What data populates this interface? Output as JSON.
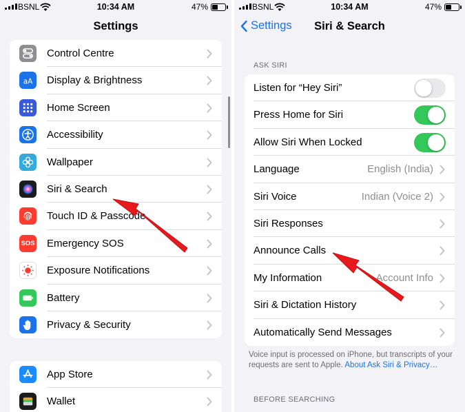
{
  "status": {
    "carrier": "BSNL",
    "time": "10:34 AM",
    "battery": "47%"
  },
  "left": {
    "title": "Settings",
    "group1": [
      {
        "label": "Control Centre",
        "icon": "control-centre-icon",
        "color": "#8e8e93"
      },
      {
        "label": "Display & Brightness",
        "icon": "display-brightness-icon",
        "color": "#1a73e8"
      },
      {
        "label": "Home Screen",
        "icon": "home-screen-icon",
        "color": "#3a5bd9"
      },
      {
        "label": "Accessibility",
        "icon": "accessibility-icon",
        "color": "#1a73e8"
      },
      {
        "label": "Wallpaper",
        "icon": "wallpaper-icon",
        "color": "#34aadc"
      },
      {
        "label": "Siri & Search",
        "icon": "siri-icon",
        "color": "#1c1c1e"
      },
      {
        "label": "Touch ID & Passcode",
        "icon": "fingerprint-icon",
        "color": "#ff3b30"
      },
      {
        "label": "Emergency SOS",
        "icon": "sos-icon",
        "color": "#ff3b30",
        "icon_text": "SOS"
      },
      {
        "label": "Exposure Notifications",
        "icon": "exposure-notifications-icon",
        "color": "#ffffff"
      },
      {
        "label": "Battery",
        "icon": "battery-icon",
        "color": "#34c759"
      },
      {
        "label": "Privacy & Security",
        "icon": "privacy-hand-icon",
        "color": "#1a73e8"
      }
    ],
    "group2": [
      {
        "label": "App Store",
        "icon": "app-store-icon",
        "color": "#1a8cff"
      },
      {
        "label": "Wallet",
        "icon": "wallet-icon",
        "color": "#1c1c1e"
      }
    ]
  },
  "right": {
    "back_label": "Settings",
    "title": "Siri & Search",
    "section1_header": "ASK SIRI",
    "rows": [
      {
        "label": "Listen for “Hey Siri”",
        "type": "toggle",
        "on": false
      },
      {
        "label": "Press Home for Siri",
        "type": "toggle",
        "on": true
      },
      {
        "label": "Allow Siri When Locked",
        "type": "toggle",
        "on": true
      },
      {
        "label": "Language",
        "type": "nav",
        "value": "English (India)"
      },
      {
        "label": "Siri Voice",
        "type": "nav",
        "value": "Indian (Voice 2)"
      },
      {
        "label": "Siri Responses",
        "type": "nav",
        "value": ""
      },
      {
        "label": "Announce Calls",
        "type": "nav",
        "value": ""
      },
      {
        "label": "My Information",
        "type": "nav",
        "value": "Account Info"
      },
      {
        "label": "Siri & Dictation History",
        "type": "nav",
        "value": ""
      },
      {
        "label": "Automatically Send Messages",
        "type": "nav",
        "value": ""
      }
    ],
    "footnote_text": "Voice input is processed on iPhone, but transcripts of your requests are sent to Apple. ",
    "footnote_link": "About Ask Siri & Privacy…",
    "section2_header": "BEFORE SEARCHING"
  },
  "colors": {
    "accent": "#1a73e8",
    "toggle_on": "#34c759",
    "arrow": "#e8191c"
  }
}
